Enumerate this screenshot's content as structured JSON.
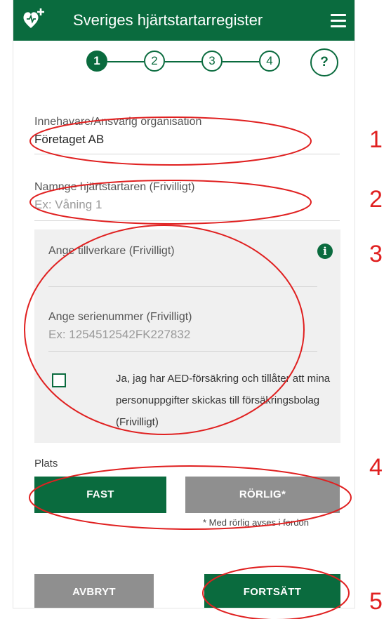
{
  "header": {
    "title": "Sveriges hjärtstartarregister",
    "brand_icon": "heart-plus-icon",
    "menu_icon": "hamburger-menu-icon"
  },
  "stepper": {
    "steps": [
      "1",
      "2",
      "3",
      "4"
    ],
    "active_step": 1,
    "help_label": "?"
  },
  "form": {
    "owner_label": "Innehavare/Ansvarig organisation",
    "owner_value": "Företaget AB",
    "name_label": "Namnge hjärtstartaren (Frivilligt)",
    "name_placeholder": "Ex: Våning 1",
    "manufacturer_label": "Ange tillverkare (Frivilligt)",
    "serial_label": "Ange serienummer (Frivilligt)",
    "serial_placeholder": "Ex: 1254512542FK227832",
    "insurance_label": "Ja, jag har AED-försäkring och tillåter att mina personuppgifter skickas till försäkringsbolag (Frivilligt)",
    "insurance_checked": false,
    "info_icon": "i"
  },
  "location": {
    "label": "Plats",
    "fixed_label": "FAST",
    "mobile_label": "RÖRLIG*",
    "note": "* Med rörlig avses i fordon"
  },
  "actions": {
    "cancel_label": "AVBRYT",
    "continue_label": "FORTSÄTT"
  },
  "annotations": [
    "1",
    "2",
    "3",
    "4",
    "5"
  ],
  "colors": {
    "brand_green": "#0a6b3e",
    "button_gray": "#8f8f8f",
    "annotation_red": "#e02020"
  }
}
